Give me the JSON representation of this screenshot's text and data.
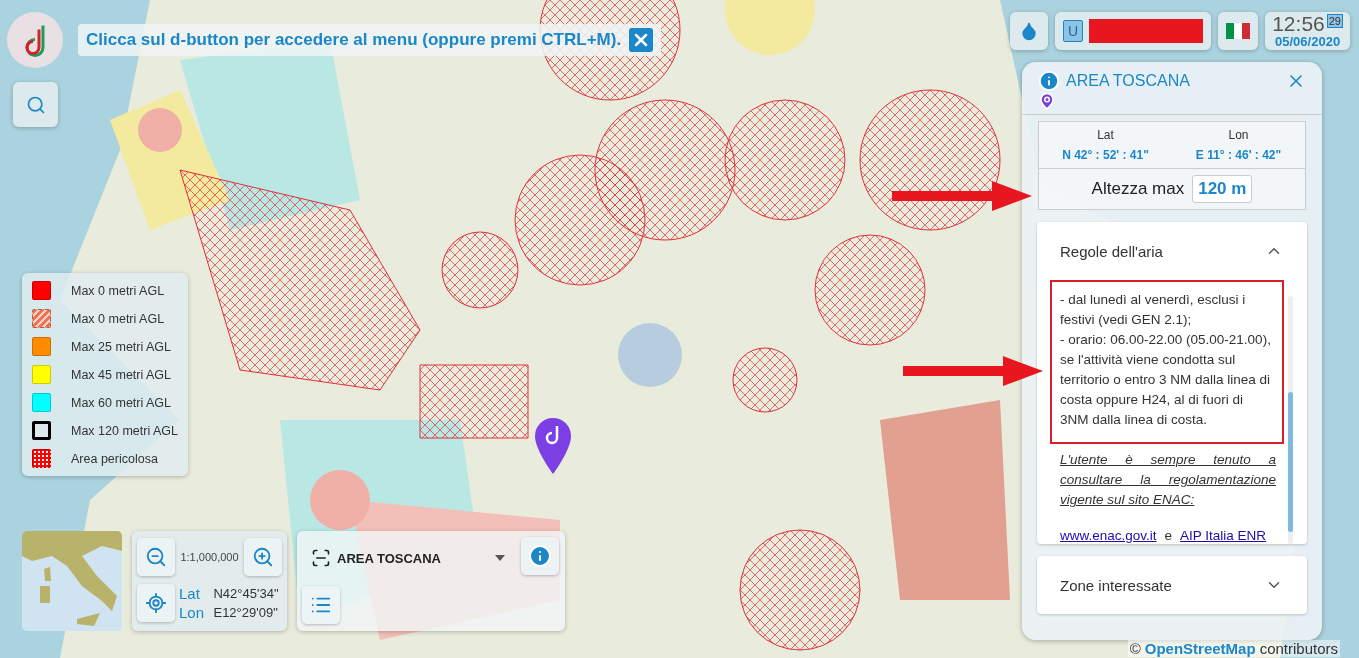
{
  "hint_banner": {
    "text": "Clicca sul d-button per accedere al menu (oppure premi CTRL+M)."
  },
  "top_bar": {
    "user_badge": "U",
    "time": "12:56",
    "seconds": "29",
    "date": "05/06/2020"
  },
  "legend": [
    {
      "label": "Max 0 metri AGL",
      "color": "#ff0000",
      "kind": "solid"
    },
    {
      "label": "Max 0 metri AGL",
      "color": "#f07050",
      "kind": "hatched"
    },
    {
      "label": "Max 25 metri AGL",
      "color": "#ff8c00",
      "kind": "solid"
    },
    {
      "label": "Max 45 metri AGL",
      "color": "#ffff00",
      "kind": "solid"
    },
    {
      "label": "Max 60 metri AGL",
      "color": "#00ffff",
      "kind": "solid"
    },
    {
      "label": "Max 120 metri AGL",
      "color": "#000000",
      "kind": "outline"
    },
    {
      "label": "Area pericolosa",
      "color": "#ff0000",
      "kind": "dotted"
    }
  ],
  "info_panel": {
    "title": "AREA TOSCANA",
    "lat_label": "Lat",
    "lon_label": "Lon",
    "lat": "N 42° : 52' : 41\"",
    "lon": "E 11° : 46' : 42\"",
    "altitude_label": "Altezza max",
    "altitude": "120 m",
    "sections": [
      {
        "title": "Regole dell'aria",
        "expanded": true,
        "rules": [
          "- dal lunedì al venerdì, esclusi i festivi (vedi GEN 2.1);",
          "- orario: 06.00-22.00 (05.00-21.00), se l'attività viene condotta sul territorio o entro 3 NM dalla linea di costa oppure H24, al di fuori di 3NM dalla linea di costa."
        ],
        "note": "L'utente è sempre tenuto a consultare la regolamentazione vigente sul sito ENAC:",
        "links": [
          "www.enac.gov.it",
          "AIP Italia ENR"
        ],
        "link_joiner": "e"
      },
      {
        "title": "Zone interessate",
        "expanded": false
      }
    ]
  },
  "scale_panel": {
    "scale": "1:1,000,000",
    "lat_label": "Lat",
    "lat": "N42°45'34\"",
    "lon_label": "Lon",
    "lon": "E12°29'09\""
  },
  "area_selector": {
    "value": "AREA TOSCANA"
  },
  "attribution": {
    "prefix": "©",
    "link": "OpenStreetMap",
    "suffix": "contributors"
  }
}
